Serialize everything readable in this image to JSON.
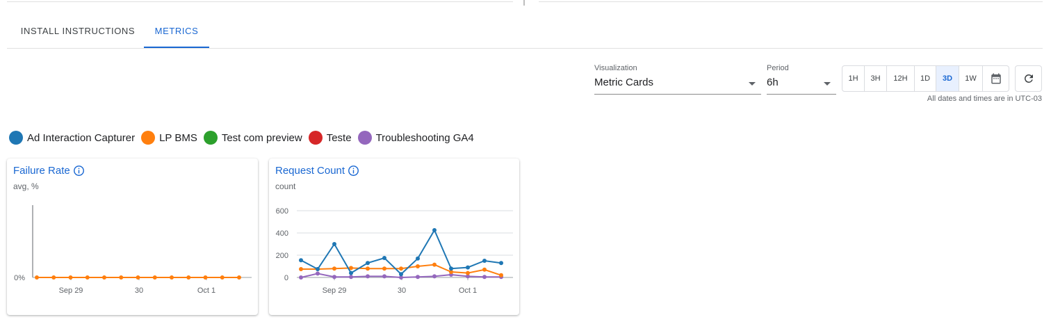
{
  "tabs": [
    {
      "label": "INSTALL INSTRUCTIONS",
      "active": false
    },
    {
      "label": "METRICS",
      "active": true
    }
  ],
  "controls": {
    "visualization": {
      "label": "Visualization",
      "value": "Metric Cards"
    },
    "period": {
      "label": "Period",
      "value": "6h"
    },
    "ranges": [
      "1H",
      "3H",
      "12H",
      "1D",
      "3D",
      "1W"
    ],
    "active_range": "3D",
    "timezone_note": "All dates and times are in UTC-03"
  },
  "legend": [
    {
      "name": "Ad Interaction Capturer",
      "color": "#1f77b4"
    },
    {
      "name": "LP BMS",
      "color": "#ff7f0e"
    },
    {
      "name": "Test com preview",
      "color": "#2ca02c"
    },
    {
      "name": "Teste",
      "color": "#d62728"
    },
    {
      "name": "Troubleshooting GA4",
      "color": "#9467bd"
    }
  ],
  "cards": [
    {
      "title": "Failure Rate",
      "subtitle": "avg, %"
    },
    {
      "title": "Request Count",
      "subtitle": "count"
    }
  ],
  "chart_data": [
    {
      "type": "line",
      "title": "Failure Rate",
      "subtitle": "avg, %",
      "x_ticks": [
        "Sep 29",
        "30",
        "Oct 1"
      ],
      "y_ticks": [
        "0%"
      ],
      "grid": true,
      "series": [
        {
          "name": "LP BMS",
          "color": "#ff7f0e",
          "values": [
            0,
            0,
            0,
            0,
            0,
            0,
            0,
            0,
            0,
            0,
            0,
            0,
            0
          ]
        }
      ]
    },
    {
      "type": "line",
      "title": "Request Count",
      "subtitle": "count",
      "x_ticks": [
        "Sep 29",
        "30",
        "Oct 1"
      ],
      "y_ticks": [
        "0",
        "200",
        "400",
        "600"
      ],
      "ylim": [
        0,
        600
      ],
      "grid": true,
      "series": [
        {
          "name": "Ad Interaction Capturer",
          "color": "#1f77b4",
          "values": [
            155,
            75,
            300,
            40,
            130,
            175,
            30,
            170,
            425,
            80,
            90,
            150,
            130
          ]
        },
        {
          "name": "LP BMS",
          "color": "#ff7f0e",
          "values": [
            75,
            75,
            80,
            85,
            80,
            80,
            80,
            100,
            115,
            50,
            40,
            70,
            20
          ]
        },
        {
          "name": "Troubleshooting GA4",
          "color": "#9467bd",
          "values": [
            0,
            35,
            5,
            5,
            10,
            10,
            0,
            5,
            10,
            25,
            10,
            5,
            5
          ]
        }
      ]
    }
  ]
}
